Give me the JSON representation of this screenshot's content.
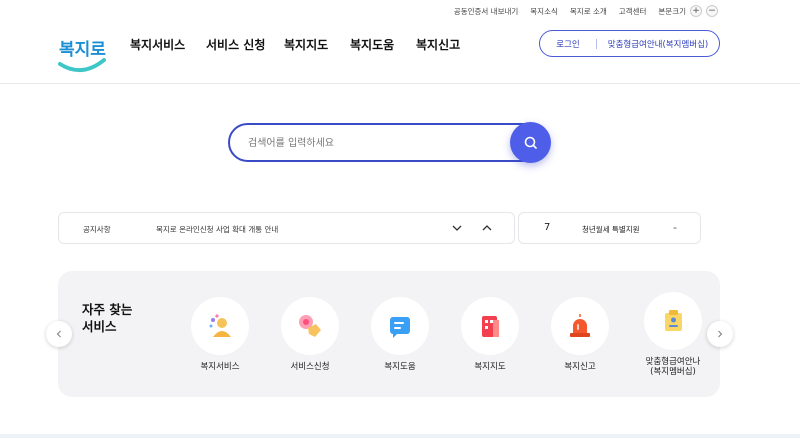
{
  "util_bar": {
    "links": [
      "공동인증서 내보내기",
      "복지소식",
      "복지로 소개",
      "고객센터"
    ],
    "font_size_label": "본문크기",
    "plus": "+",
    "minus": "−"
  },
  "logo": {
    "text": "복지로"
  },
  "gnb": [
    "복지서비스",
    "서비스 신청",
    "복지지도",
    "복지도움",
    "복지신고"
  ],
  "login": {
    "login_label": "로그인",
    "membership_label": "맞춤형급여안내(복지멤버십)"
  },
  "search": {
    "placeholder": "검색어를 입력하세요",
    "value": ""
  },
  "notice": {
    "label": "공지사항",
    "title": "복지로 온라인신청 사업 확대 개통 안내"
  },
  "side_item": {
    "number": "7",
    "text": "청년월세 특별지원",
    "dash": "-"
  },
  "frequent": {
    "title_line1": "자주 찾는",
    "title_line2": "서비스",
    "items": [
      {
        "label": "복지서비스",
        "icon": "welfare-service-icon"
      },
      {
        "label": "서비스신청",
        "icon": "service-apply-icon"
      },
      {
        "label": "복지도움",
        "icon": "welfare-help-icon"
      },
      {
        "label": "복지지도",
        "icon": "welfare-map-icon"
      },
      {
        "label": "복지신고",
        "icon": "welfare-report-icon"
      },
      {
        "label": "맞춤형급여안나",
        "label2": "(복지멤버십)",
        "icon": "benefit-guide-icon"
      }
    ]
  },
  "colors": {
    "accent": "#4e5ee8",
    "accent_dark": "#3a4bc8",
    "panel": "#f3f3f5",
    "logo_blue": "#1b8fd6",
    "logo_teal": "#3fc6c6"
  }
}
